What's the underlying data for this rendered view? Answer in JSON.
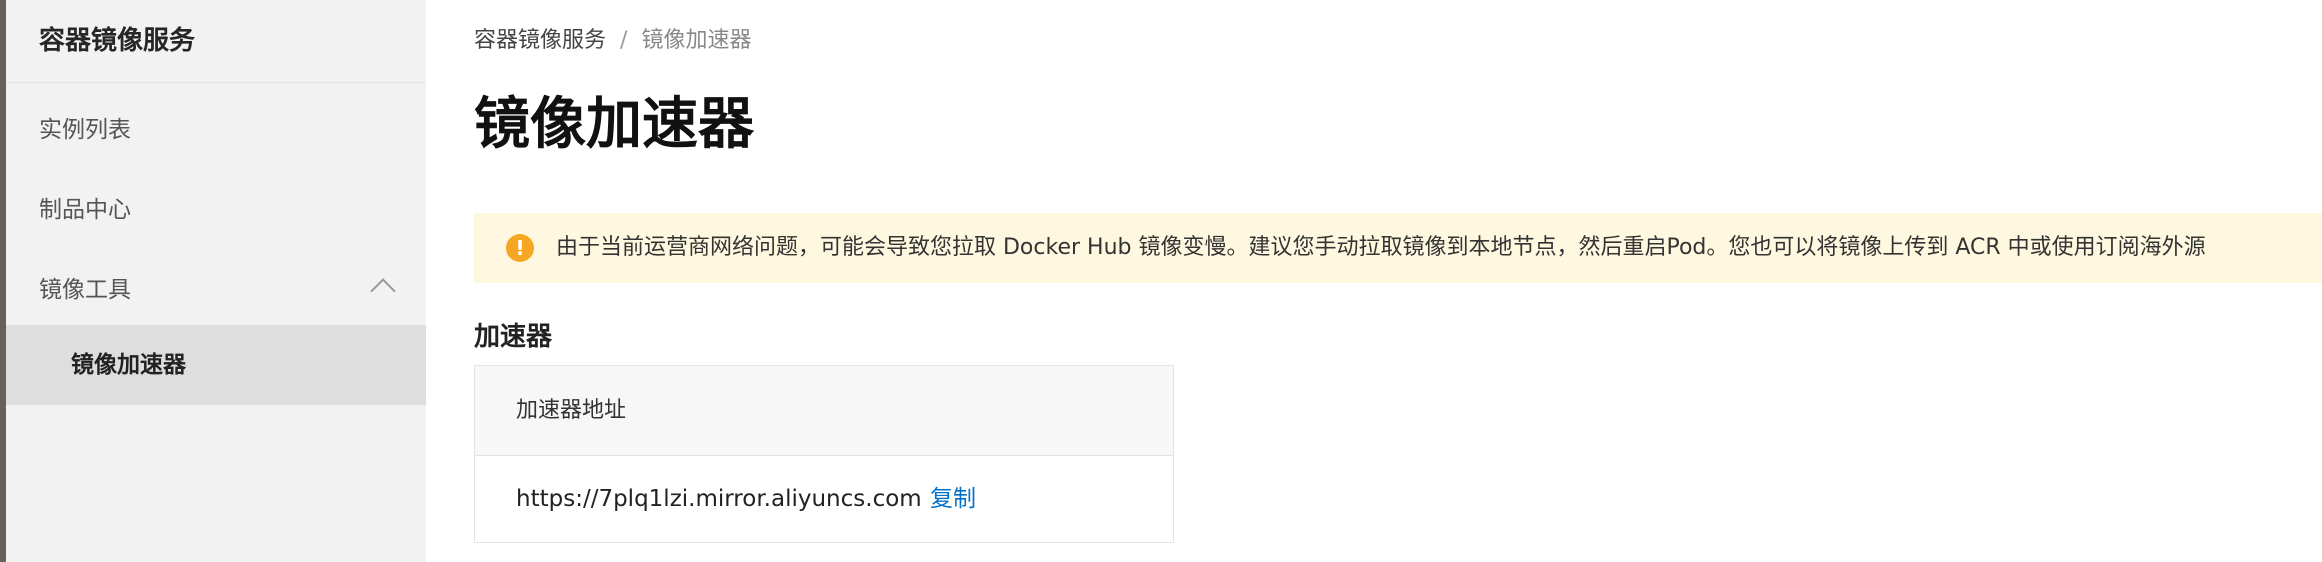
{
  "sidebar": {
    "title": "容器镜像服务",
    "items": [
      {
        "label": "实例列表"
      },
      {
        "label": "制品中心"
      },
      {
        "label": "镜像工具",
        "expanded": true
      },
      {
        "label": "镜像加速器",
        "active": true
      }
    ]
  },
  "breadcrumb": {
    "root": "容器镜像服务",
    "separator": "/",
    "current": "镜像加速器"
  },
  "page_title": "镜像加速器",
  "alert": {
    "icon": "warning-icon",
    "text": "由于当前运营商网络问题，可能会导致您拉取 Docker Hub 镜像变慢。建议您手动拉取镜像到本地节点，然后重启Pod。您也可以将镜像上传到 ACR 中或使用订阅海外源"
  },
  "section": {
    "title": "加速器",
    "header": "加速器地址",
    "address": "https://7plq1lzi.mirror.aliyuncs.com",
    "copy_label": "复制"
  },
  "colors": {
    "accent": "#0070cc",
    "alert_bg": "#fff8e0",
    "warning": "#f5a623"
  }
}
